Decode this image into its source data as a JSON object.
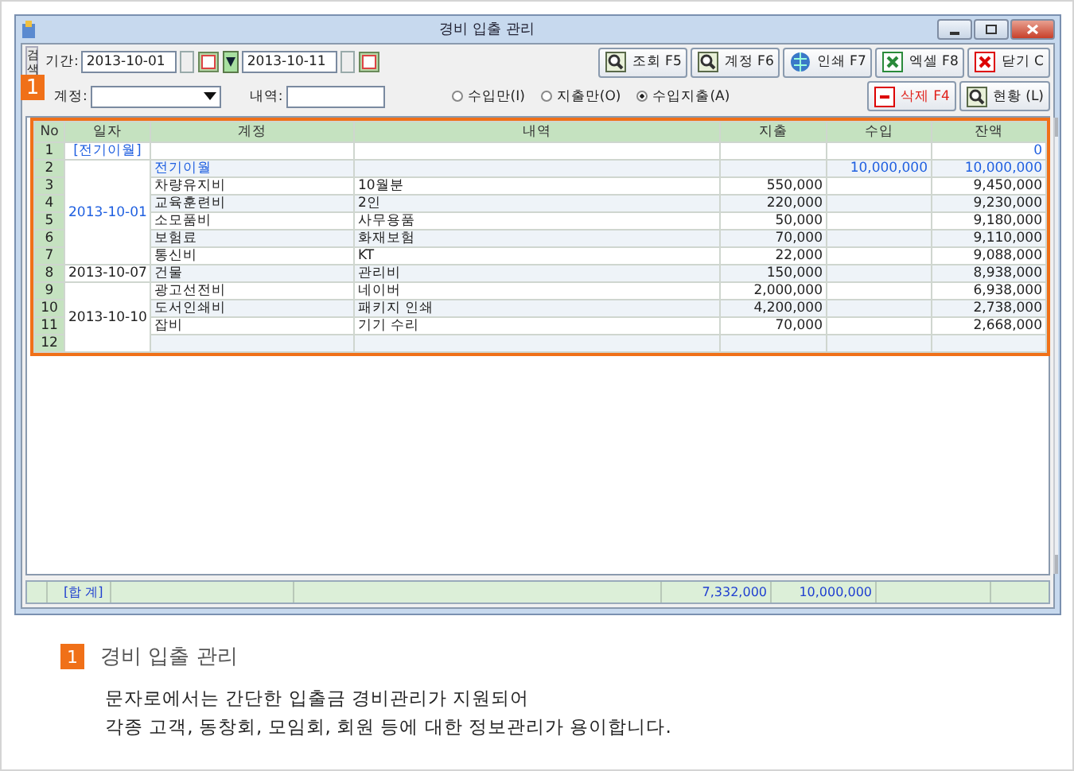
{
  "window": {
    "title": "경비 입출 관리"
  },
  "side_tab": "검색",
  "filters": {
    "period_label": "기간:",
    "date_from": "2013-10-01",
    "date_to": "2013-10-11",
    "account_label": "계정:",
    "memo_label": "내역:"
  },
  "radios": [
    {
      "label": "수입만(I)",
      "selected": false
    },
    {
      "label": "지출만(O)",
      "selected": false
    },
    {
      "label": "수입지출(A)",
      "selected": true
    }
  ],
  "buttons": [
    {
      "label": "조회 F5",
      "kind": "search",
      "danger": false
    },
    {
      "label": "계정 F6",
      "kind": "search",
      "danger": false
    },
    {
      "label": "인쇄 F7",
      "kind": "globe",
      "danger": false
    },
    {
      "label": "엑셀 F8",
      "kind": "excel",
      "danger": false
    },
    {
      "label": "닫기 C",
      "kind": "close",
      "danger": false
    }
  ],
  "buttons_row2": [
    {
      "label": "삭제 F4",
      "kind": "minus",
      "danger": true
    },
    {
      "label": "현황 (L)",
      "kind": "search",
      "danger": false
    }
  ],
  "annotation": "1",
  "table": {
    "columns": [
      "No",
      "일자",
      "계정",
      "내역",
      "지출",
      "수입",
      "잔액"
    ],
    "groups": [
      {
        "date": "[전기이월]",
        "highlight": true,
        "rows": [
          {
            "no": "1",
            "balance": "0",
            "highlight": true
          }
        ]
      },
      {
        "date": "2013-10-01",
        "highlight": true,
        "rows": [
          {
            "no": "2",
            "account": "전기이월",
            "income": "10,000,000",
            "balance": "10,000,000",
            "highlight": true
          },
          {
            "no": "3",
            "account": "차량유지비",
            "memo": "10월분",
            "expense": "550,000",
            "balance": "9,450,000",
            "highlight": false
          },
          {
            "no": "4",
            "account": "교육훈련비",
            "memo": "2인",
            "expense": "220,000",
            "balance": "9,230,000",
            "highlight": false
          },
          {
            "no": "5",
            "account": "소모품비",
            "memo": "사무용품",
            "expense": "50,000",
            "balance": "9,180,000",
            "highlight": false
          },
          {
            "no": "6",
            "account": "보험료",
            "memo": "화재보험",
            "expense": "70,000",
            "balance": "9,110,000",
            "highlight": false
          },
          {
            "no": "7",
            "account": "통신비",
            "memo": "KT",
            "expense": "22,000",
            "balance": "9,088,000",
            "highlight": false
          }
        ]
      },
      {
        "date": "2013-10-07",
        "highlight": false,
        "rows": [
          {
            "no": "8",
            "account": "건물",
            "memo": "관리비",
            "expense": "150,000",
            "balance": "8,938,000",
            "highlight": false
          }
        ]
      },
      {
        "date": "2013-10-10",
        "highlight": false,
        "rows": [
          {
            "no": "9",
            "account": "광고선전비",
            "memo": "네이버",
            "expense": "2,000,000",
            "balance": "6,938,000",
            "highlight": false
          },
          {
            "no": "10",
            "account": "도서인쇄비",
            "memo": "패키지 인쇄",
            "expense": "4,200,000",
            "balance": "2,738,000",
            "highlight": false
          },
          {
            "no": "11",
            "account": "잡비",
            "memo": "기기 수리",
            "expense": "70,000",
            "balance": "2,668,000",
            "highlight": false
          },
          {
            "no": "12"
          }
        ]
      }
    ]
  },
  "totals": {
    "label": "[합 계]",
    "expense": "7,332,000",
    "income": "10,000,000"
  },
  "caption": {
    "number": "1",
    "title": "경비 입출 관리",
    "lines": [
      "문자로에서는 간단한 입출금 경비관리가 지원되어",
      "각종 고객, 동창회, 모임회, 회원 등에 대한 정보관리가 용이합니다."
    ]
  }
}
